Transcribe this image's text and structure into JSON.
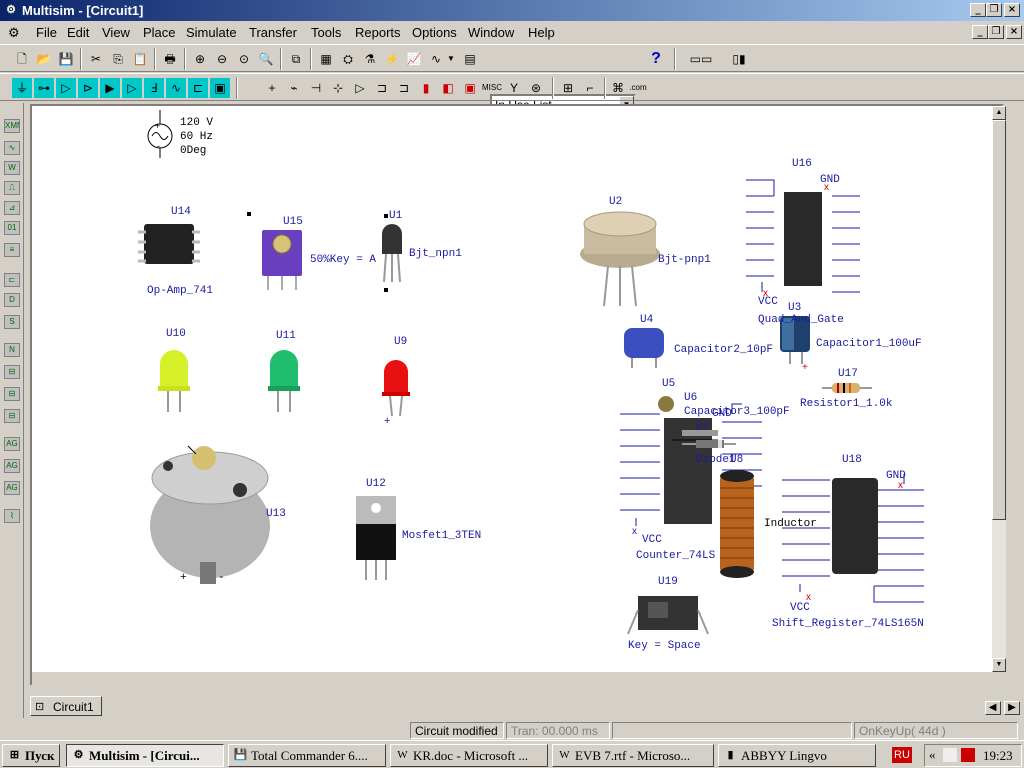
{
  "window": {
    "app_icon": "multisim-icon",
    "title": "Multisim - [Circuit1]"
  },
  "menu": [
    "File",
    "Edit",
    "View",
    "Place",
    "Simulate",
    "Transfer",
    "Tools",
    "Reports",
    "Options",
    "Window",
    "Help"
  ],
  "toolbar": {
    "in_use_list": "In Use List"
  },
  "source": {
    "voltage": "120 V",
    "freq": "60 Hz",
    "phase": "0Deg"
  },
  "components": {
    "u14": {
      "ref": "U14",
      "name": "Op-Amp_741"
    },
    "u15": {
      "ref": "U15",
      "name": "50%Key = A"
    },
    "u1": {
      "ref": "U1",
      "name": "Bjt_npn1"
    },
    "u2": {
      "ref": "U2",
      "name": "Bjt-pnp1"
    },
    "u16": {
      "ref": "U16",
      "name": "Quad_And_Gate",
      "gnd": "GND",
      "vcc": "VCC"
    },
    "u3": {
      "ref": "U3",
      "name": "Capacitor1_100uF"
    },
    "u4": {
      "ref": "U4",
      "name": "Capacitor2_10pF"
    },
    "u10": {
      "ref": "U10"
    },
    "u11": {
      "ref": "U11"
    },
    "u9": {
      "ref": "U9"
    },
    "u17": {
      "ref": "U17",
      "name": "Resistor1_1.0k"
    },
    "u5": {
      "ref": "U5"
    },
    "u6": {
      "ref": "U6",
      "name": "Capacitor3_100pF"
    },
    "u7": {
      "ref": "U7",
      "name": "Diode1"
    },
    "u8": {
      "ref": "U8",
      "name": "Inductor"
    },
    "u13": {
      "ref": "U13",
      "plus": "+",
      "minus": "-"
    },
    "u12": {
      "ref": "U12",
      "name": "Mosfet1_3TEN"
    },
    "u20": {
      "name": "Counter_74LS",
      "vcc": "VCC",
      "gnd": "GND"
    },
    "u18": {
      "ref": "U18",
      "name": "Shift_Register_74LS165N",
      "gnd": "GND",
      "vcc": "VCC"
    },
    "u19": {
      "ref": "U19",
      "name": "Key = Space"
    }
  },
  "tab": {
    "label": "Circuit1"
  },
  "status": {
    "modified": "Circuit modified",
    "tran": "Tran: 00.000 ms",
    "keyup": "OnKeyUp( 44d )"
  },
  "taskbar": {
    "start": "Пуск",
    "items": [
      "Multisim - [Circui...",
      "Total Commander 6....",
      "KR.doc - Microsoft ...",
      "EVB 7.rtf - Microso...",
      "ABBYY Lingvo"
    ],
    "lang": "RU",
    "time": "19:23"
  },
  "colors": {
    "title_start": "#0a246a",
    "title_end": "#a6caf0",
    "label_blue": "#1a1aa0"
  }
}
